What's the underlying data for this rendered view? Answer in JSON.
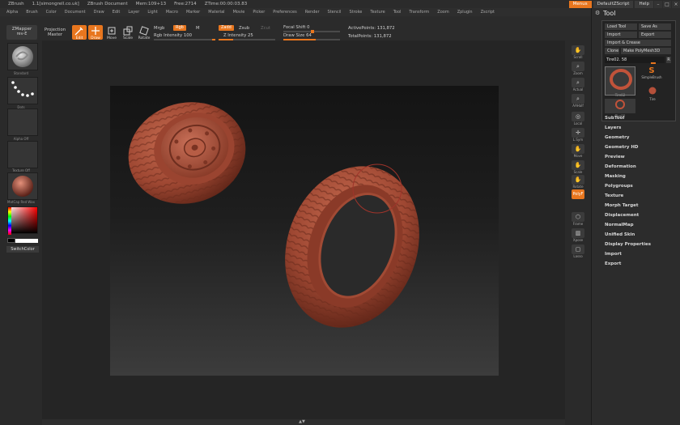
{
  "titlebar": {
    "app": "ZBrush",
    "version": "1.1[simongrell.co.uk]",
    "document": "ZBrush Document",
    "mem": "Mem:109+13",
    "free": "Free:2714",
    "timer": "ZTime:00:00:03.83",
    "menus_btn": "Menus",
    "script_btn": "DefaultZScript",
    "help_btn": "Help"
  },
  "menubar": [
    "Alpha",
    "Brush",
    "Color",
    "Document",
    "Draw",
    "Edit",
    "Layer",
    "Light",
    "Macro",
    "Marker",
    "Material",
    "Movie",
    "Picker",
    "Preferences",
    "Render",
    "Stencil",
    "Stroke",
    "Texture",
    "Tool",
    "Transform",
    "Zoom",
    "Zplugin",
    "Zscript"
  ],
  "toolbar": {
    "zmapper": "ZMapper",
    "zmapper_sub": "rev-E",
    "projection": "Projection",
    "projection_sub": "Master",
    "edit": "Edit",
    "draw": "Draw",
    "move": "Move",
    "scale": "Scale",
    "rotate": "Rotate",
    "mrgb": "Mrgb",
    "rgb": "Rgb",
    "m": "M",
    "rgb_intensity": "Rgb Intensity 100",
    "zadd": "Zadd",
    "zsub": "Zsub",
    "zcut": "Zcut",
    "z_intensity": "Z Intensity 25",
    "focal_shift": "Focal Shift 0",
    "draw_size": "Draw Size 64",
    "active_points": "ActivePoints: 131,872",
    "total_points": "TotalPoints: 131,872"
  },
  "leftshelf": {
    "brush_label": "Standard",
    "stroke_label": "Dots",
    "alpha_label": "Alpha Off",
    "texture_label": "Texture Off",
    "material_label": "MatCap Red Wax",
    "switch_color": "SwitchColor"
  },
  "rightshelf": [
    "Scroll",
    "Zoom",
    "Actual",
    "AAHalf",
    "Local",
    "L.Sym",
    "Move",
    "Scale",
    "Rotate",
    "PolyF",
    "Frame",
    "Xpose",
    "Lasso"
  ],
  "palette": {
    "title": "Tool",
    "load_tool": "Load Tool",
    "save_as": "Save As",
    "import": "Import",
    "export": "Export",
    "import_crease": "Import & Crease",
    "clone": "Clone",
    "make_polymesh": "Make PolyMesh3D",
    "current_tool": "Tire02. 58",
    "tool_r": "R",
    "thumb1": "Tire02",
    "simple_brush": "SimpleBrush",
    "tire_label": "Tire",
    "thumb2": "Tire02",
    "sections": [
      "SubTool",
      "Layers",
      "Geometry",
      "Geometry HD",
      "Preview",
      "Deformation",
      "Masking",
      "Polygroups",
      "Texture",
      "Morph Target",
      "Displacement",
      "NormalMap",
      "Unified Skin",
      "Display Properties",
      "Import",
      "Export"
    ]
  },
  "colors": {
    "accent": "#e8761e",
    "tire": "#a8523a",
    "background": "#262626"
  }
}
